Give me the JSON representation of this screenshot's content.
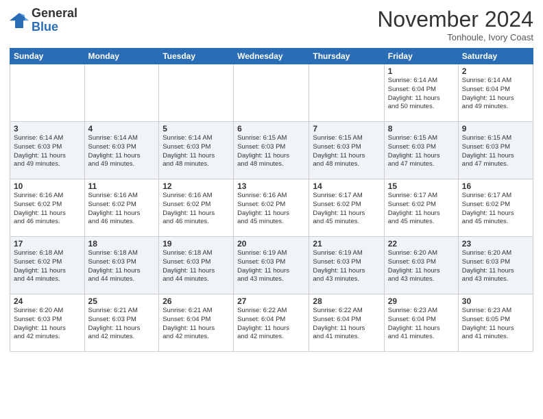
{
  "logo": {
    "line1": "General",
    "line2": "Blue"
  },
  "header": {
    "month": "November 2024",
    "location": "Tonhoule, Ivory Coast"
  },
  "weekdays": [
    "Sunday",
    "Monday",
    "Tuesday",
    "Wednesday",
    "Thursday",
    "Friday",
    "Saturday"
  ],
  "rows": [
    [
      {
        "day": "",
        "info": ""
      },
      {
        "day": "",
        "info": ""
      },
      {
        "day": "",
        "info": ""
      },
      {
        "day": "",
        "info": ""
      },
      {
        "day": "",
        "info": ""
      },
      {
        "day": "1",
        "info": "Sunrise: 6:14 AM\nSunset: 6:04 PM\nDaylight: 11 hours\nand 50 minutes."
      },
      {
        "day": "2",
        "info": "Sunrise: 6:14 AM\nSunset: 6:04 PM\nDaylight: 11 hours\nand 49 minutes."
      }
    ],
    [
      {
        "day": "3",
        "info": "Sunrise: 6:14 AM\nSunset: 6:03 PM\nDaylight: 11 hours\nand 49 minutes."
      },
      {
        "day": "4",
        "info": "Sunrise: 6:14 AM\nSunset: 6:03 PM\nDaylight: 11 hours\nand 49 minutes."
      },
      {
        "day": "5",
        "info": "Sunrise: 6:14 AM\nSunset: 6:03 PM\nDaylight: 11 hours\nand 48 minutes."
      },
      {
        "day": "6",
        "info": "Sunrise: 6:15 AM\nSunset: 6:03 PM\nDaylight: 11 hours\nand 48 minutes."
      },
      {
        "day": "7",
        "info": "Sunrise: 6:15 AM\nSunset: 6:03 PM\nDaylight: 11 hours\nand 48 minutes."
      },
      {
        "day": "8",
        "info": "Sunrise: 6:15 AM\nSunset: 6:03 PM\nDaylight: 11 hours\nand 47 minutes."
      },
      {
        "day": "9",
        "info": "Sunrise: 6:15 AM\nSunset: 6:03 PM\nDaylight: 11 hours\nand 47 minutes."
      }
    ],
    [
      {
        "day": "10",
        "info": "Sunrise: 6:16 AM\nSunset: 6:02 PM\nDaylight: 11 hours\nand 46 minutes."
      },
      {
        "day": "11",
        "info": "Sunrise: 6:16 AM\nSunset: 6:02 PM\nDaylight: 11 hours\nand 46 minutes."
      },
      {
        "day": "12",
        "info": "Sunrise: 6:16 AM\nSunset: 6:02 PM\nDaylight: 11 hours\nand 46 minutes."
      },
      {
        "day": "13",
        "info": "Sunrise: 6:16 AM\nSunset: 6:02 PM\nDaylight: 11 hours\nand 45 minutes."
      },
      {
        "day": "14",
        "info": "Sunrise: 6:17 AM\nSunset: 6:02 PM\nDaylight: 11 hours\nand 45 minutes."
      },
      {
        "day": "15",
        "info": "Sunrise: 6:17 AM\nSunset: 6:02 PM\nDaylight: 11 hours\nand 45 minutes."
      },
      {
        "day": "16",
        "info": "Sunrise: 6:17 AM\nSunset: 6:02 PM\nDaylight: 11 hours\nand 45 minutes."
      }
    ],
    [
      {
        "day": "17",
        "info": "Sunrise: 6:18 AM\nSunset: 6:02 PM\nDaylight: 11 hours\nand 44 minutes."
      },
      {
        "day": "18",
        "info": "Sunrise: 6:18 AM\nSunset: 6:03 PM\nDaylight: 11 hours\nand 44 minutes."
      },
      {
        "day": "19",
        "info": "Sunrise: 6:18 AM\nSunset: 6:03 PM\nDaylight: 11 hours\nand 44 minutes."
      },
      {
        "day": "20",
        "info": "Sunrise: 6:19 AM\nSunset: 6:03 PM\nDaylight: 11 hours\nand 43 minutes."
      },
      {
        "day": "21",
        "info": "Sunrise: 6:19 AM\nSunset: 6:03 PM\nDaylight: 11 hours\nand 43 minutes."
      },
      {
        "day": "22",
        "info": "Sunrise: 6:20 AM\nSunset: 6:03 PM\nDaylight: 11 hours\nand 43 minutes."
      },
      {
        "day": "23",
        "info": "Sunrise: 6:20 AM\nSunset: 6:03 PM\nDaylight: 11 hours\nand 43 minutes."
      }
    ],
    [
      {
        "day": "24",
        "info": "Sunrise: 6:20 AM\nSunset: 6:03 PM\nDaylight: 11 hours\nand 42 minutes."
      },
      {
        "day": "25",
        "info": "Sunrise: 6:21 AM\nSunset: 6:03 PM\nDaylight: 11 hours\nand 42 minutes."
      },
      {
        "day": "26",
        "info": "Sunrise: 6:21 AM\nSunset: 6:04 PM\nDaylight: 11 hours\nand 42 minutes."
      },
      {
        "day": "27",
        "info": "Sunrise: 6:22 AM\nSunset: 6:04 PM\nDaylight: 11 hours\nand 42 minutes."
      },
      {
        "day": "28",
        "info": "Sunrise: 6:22 AM\nSunset: 6:04 PM\nDaylight: 11 hours\nand 41 minutes."
      },
      {
        "day": "29",
        "info": "Sunrise: 6:23 AM\nSunset: 6:04 PM\nDaylight: 11 hours\nand 41 minutes."
      },
      {
        "day": "30",
        "info": "Sunrise: 6:23 AM\nSunset: 6:05 PM\nDaylight: 11 hours\nand 41 minutes."
      }
    ]
  ]
}
